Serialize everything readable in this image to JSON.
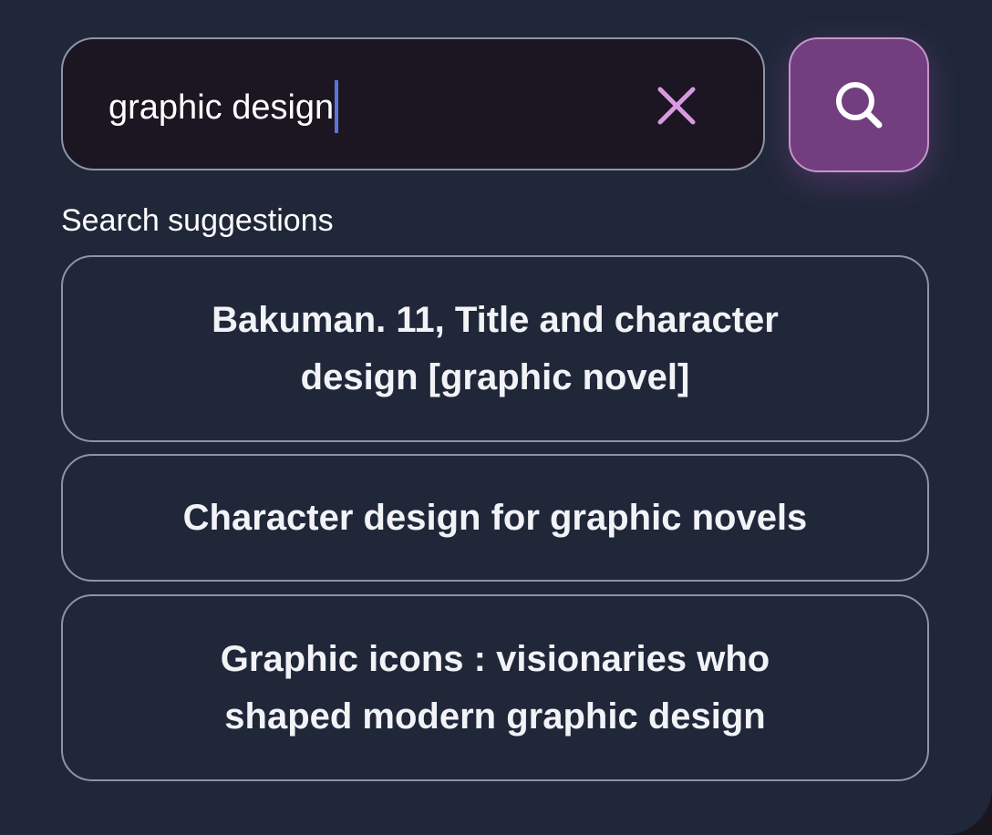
{
  "search": {
    "value": "graphic design",
    "clear_icon": "close-icon",
    "submit_icon": "search-icon"
  },
  "suggestions": {
    "heading": "Search suggestions",
    "items": [
      {
        "label": "Bakuman. 11, Title and character design [graphic novel]"
      },
      {
        "label": "Character design for graphic novels"
      },
      {
        "label": "Graphic icons : visionaries who shaped modern graphic design"
      }
    ]
  },
  "colors": {
    "panel_background": "#202739",
    "input_background": "#1b1622",
    "border": "#8d94a8",
    "accent": "#733e80",
    "clear_icon": "#d79ae0",
    "caret": "#5e74d6"
  }
}
